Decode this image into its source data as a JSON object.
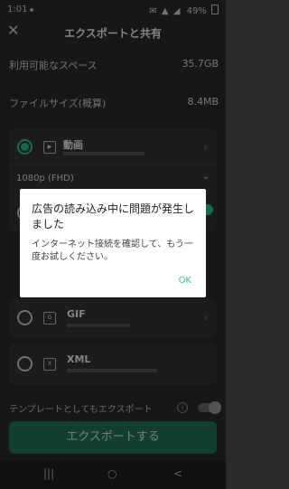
{
  "status": {
    "time": "1:01",
    "battery": "49%",
    "icons": "✉ ▲ ◢"
  },
  "header": {
    "close": "✕",
    "title": "エクスポートと共有"
  },
  "info": {
    "available_label": "利用可能なスペース",
    "available_value": "35.7GB",
    "filesize_label": "ファイルサイズ(概算)",
    "filesize_value": "8.4MB"
  },
  "formats": {
    "video": {
      "name": "動画",
      "resolution": "1080p (FHD)"
    },
    "gif": {
      "name": "GIF"
    },
    "xml": {
      "name": "XML"
    }
  },
  "template_label": "テンプレートとしてもエクスポート",
  "export_button": "エクスポートする",
  "dialog": {
    "title": "広告の読み込み中に問題が発生しました",
    "message": "インターネット接続を確認して、もう一度お試しください。",
    "ok": "OK"
  },
  "nav": {
    "recents": "|||",
    "home": "○",
    "back": "<"
  }
}
